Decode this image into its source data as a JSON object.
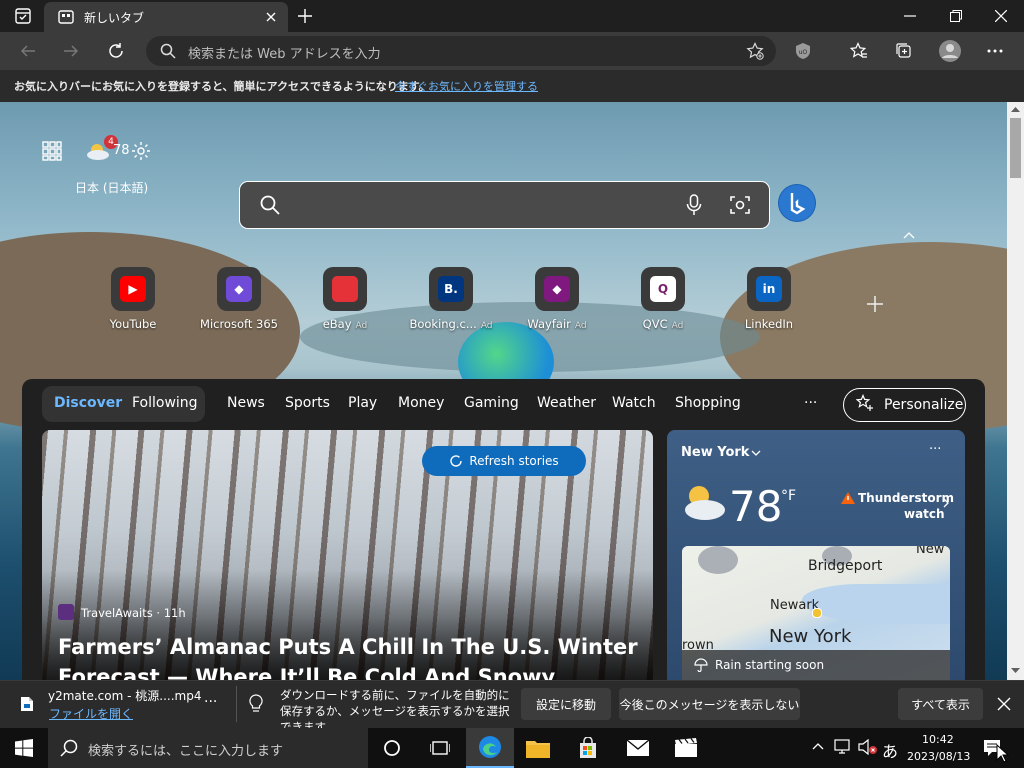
{
  "tab": {
    "title": "新しいタブ"
  },
  "address": {
    "placeholder": "検索または Web アドレスを入力"
  },
  "favorites_prompt": {
    "message": "お気に入りバーにお気に入りを登録すると、簡単にアクセスできるようになります。",
    "link": "今すぐお気に入りを管理する"
  },
  "ntp": {
    "weather_badge": "4",
    "temperature_short": "78",
    "language": "日本 (日本語)",
    "tiles": [
      {
        "label": "YouTube",
        "ad": ""
      },
      {
        "label": "Microsoft 365",
        "ad": ""
      },
      {
        "label": "eBay",
        "ad": "Ad"
      },
      {
        "label": "Booking.c...",
        "ad": "Ad"
      },
      {
        "label": "Wayfair",
        "ad": "Ad"
      },
      {
        "label": "QVC",
        "ad": "Ad"
      },
      {
        "label": "LinkedIn",
        "ad": ""
      }
    ],
    "tile_glyphs": [
      "▶",
      "◆",
      "",
      "B.",
      "◆",
      "Q",
      "in"
    ]
  },
  "feed": {
    "nav": [
      "Discover",
      "Following",
      "News",
      "Sports",
      "Play",
      "Money",
      "Gaming",
      "Weather",
      "Watch",
      "Shopping"
    ],
    "more": "···",
    "personalize": "Personalize",
    "refresh": "Refresh stories",
    "story": {
      "source": "TravelAwaits · 11h",
      "headline": "Farmers’ Almanac Puts A Chill In The U.S. Winter Forecast — Where It’ll Be Cold And Snowy"
    },
    "weather": {
      "location": "New York",
      "temp": "78",
      "unit": "°F",
      "alert_line1": "Thunderstorm",
      "alert_line2": "watch",
      "map_labels": [
        "Bridgeport",
        "Newark",
        "New York",
        "New",
        "rown"
      ],
      "rain": "Rain starting soon",
      "more": "···"
    }
  },
  "download": {
    "filename": "y2mate.com - 桃源....mp4",
    "open": "ファイルを開く",
    "more": "···",
    "notice": "ダウンロードする前に、ファイルを自動的に保存するか、メッセージを表示するかを選択できます。",
    "settings": "設定に移動",
    "dont_show": "今後このメッセージを表示しない",
    "show_all": "すべて表示"
  },
  "taskbar": {
    "search_placeholder": "検索するには、ここに入力します",
    "ime": "あ",
    "time": "10:42",
    "date": "2023/08/13"
  },
  "colors": {
    "accent": "#0f6cbd",
    "link": "#6cb8ff"
  }
}
